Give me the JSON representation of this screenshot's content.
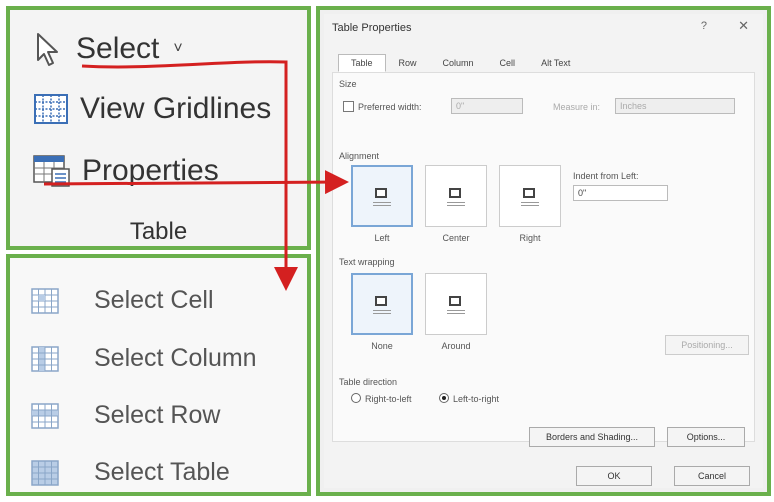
{
  "ribbon": {
    "select_label": "Select",
    "select_caret": "˅",
    "gridlines_label": "View Gridlines",
    "properties_label": "Properties",
    "group_label": "Table"
  },
  "select_menu": {
    "items": [
      {
        "label": "Select Cell"
      },
      {
        "label": "Select Column"
      },
      {
        "label": "Select Row"
      },
      {
        "label": "Select Table"
      }
    ]
  },
  "dialog": {
    "title": "Table Properties",
    "help": "?",
    "close": "✕",
    "tabs": [
      {
        "label": "Table",
        "active": true
      },
      {
        "label": "Row",
        "active": false
      },
      {
        "label": "Column",
        "active": false
      },
      {
        "label": "Cell",
        "active": false
      },
      {
        "label": "Alt Text",
        "active": false
      }
    ],
    "size": {
      "heading": "Size",
      "preferred_width_label": "Preferred width:",
      "preferred_width_value": "0\"",
      "measure_in_label": "Measure in:",
      "measure_in_value": "Inches"
    },
    "alignment": {
      "heading": "Alignment",
      "options": [
        {
          "label": "Left",
          "selected": true
        },
        {
          "label": "Center",
          "selected": false
        },
        {
          "label": "Right",
          "selected": false
        }
      ],
      "indent_label": "Indent from Left:",
      "indent_value": "0\""
    },
    "wrapping": {
      "heading": "Text wrapping",
      "options": [
        {
          "label": "None",
          "selected": true
        },
        {
          "label": "Around",
          "selected": false
        }
      ],
      "positioning_label": "Positioning..."
    },
    "direction": {
      "heading": "Table direction",
      "rtl_label": "Right-to-left",
      "ltr_label": "Left-to-right",
      "selected": "ltr"
    },
    "borders_label": "Borders and Shading...",
    "options_label": "Options...",
    "ok_label": "OK",
    "cancel_label": "Cancel"
  },
  "colors": {
    "frame": "#6ab04c",
    "annotation": "#d42020",
    "selected_option": "#7aa6d6"
  }
}
